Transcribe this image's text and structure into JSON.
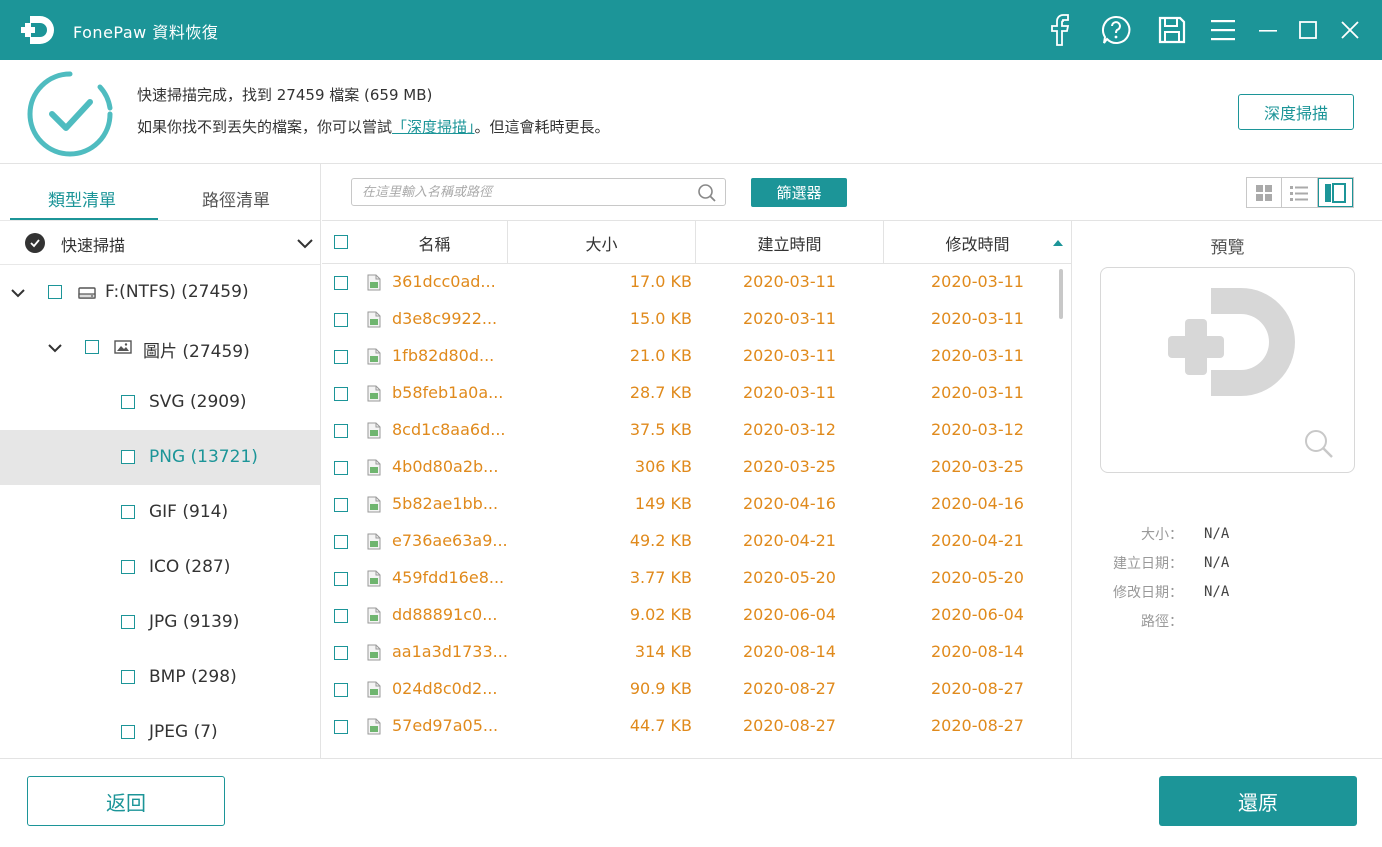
{
  "app": {
    "title": "FonePaw 資料恢復"
  },
  "status": {
    "line1": "快速掃描完成，找到 27459 檔案 (659 MB)",
    "line2_prefix": "如果你找不到丟失的檔案，你可以嘗試",
    "line2_link": "「深度掃描」",
    "line2_suffix": "。但這會耗時更長。",
    "deep_scan_button": "深度掃描"
  },
  "left_panel": {
    "tabs": [
      {
        "label": "類型清單"
      },
      {
        "label": "路徑清單"
      }
    ],
    "scan_mode": "快速掃描",
    "tree": [
      {
        "label": "F:(NTFS) (27459)",
        "level": 0
      },
      {
        "label": "圖片 (27459)",
        "level": 1
      },
      {
        "label": "SVG (2909)",
        "level": 2
      },
      {
        "label": "PNG (13721)",
        "level": 2
      },
      {
        "label": "GIF (914)",
        "level": 2
      },
      {
        "label": "ICO (287)",
        "level": 2
      },
      {
        "label": "JPG (9139)",
        "level": 2
      },
      {
        "label": "BMP (298)",
        "level": 2
      },
      {
        "label": "JPEG (7)",
        "level": 2
      }
    ]
  },
  "toolbar": {
    "search_placeholder": "在這里輸入名稱或路徑",
    "filter_button": "篩選器"
  },
  "table": {
    "headers": {
      "name": "名稱",
      "size": "大小",
      "created": "建立時間",
      "modified": "修改時間"
    },
    "rows": [
      {
        "name": "361dcc0ad...",
        "size": "17.0 KB",
        "created": "2020-03-11",
        "modified": "2020-03-11"
      },
      {
        "name": "d3e8c9922...",
        "size": "15.0 KB",
        "created": "2020-03-11",
        "modified": "2020-03-11"
      },
      {
        "name": "1fb82d80d...",
        "size": "21.0 KB",
        "created": "2020-03-11",
        "modified": "2020-03-11"
      },
      {
        "name": "b58feb1a0a...",
        "size": "28.7 KB",
        "created": "2020-03-11",
        "modified": "2020-03-11"
      },
      {
        "name": "8cd1c8aa6d...",
        "size": "37.5 KB",
        "created": "2020-03-12",
        "modified": "2020-03-12"
      },
      {
        "name": "4b0d80a2b...",
        "size": "306 KB",
        "created": "2020-03-25",
        "modified": "2020-03-25"
      },
      {
        "name": "5b82ae1bb...",
        "size": "149 KB",
        "created": "2020-04-16",
        "modified": "2020-04-16"
      },
      {
        "name": "e736ae63a9...",
        "size": "49.2 KB",
        "created": "2020-04-21",
        "modified": "2020-04-21"
      },
      {
        "name": "459fdd16e8...",
        "size": "3.77 KB",
        "created": "2020-05-20",
        "modified": "2020-05-20"
      },
      {
        "name": "dd88891c0...",
        "size": "9.02 KB",
        "created": "2020-06-04",
        "modified": "2020-06-04"
      },
      {
        "name": "aa1a3d1733...",
        "size": "314 KB",
        "created": "2020-08-14",
        "modified": "2020-08-14"
      },
      {
        "name": "024d8c0d2...",
        "size": "90.9 KB",
        "created": "2020-08-27",
        "modified": "2020-08-27"
      },
      {
        "name": "57ed97a05...",
        "size": "44.7 KB",
        "created": "2020-08-27",
        "modified": "2020-08-27"
      }
    ]
  },
  "preview": {
    "title": "預覽",
    "size_label": "大小：",
    "size_value": "N/A",
    "created_label": "建立日期：",
    "created_value": "N/A",
    "modified_label": "修改日期：",
    "modified_value": "N/A",
    "path_label": "路徑："
  },
  "footer": {
    "back_button": "返回",
    "restore_button": "還原"
  },
  "colors": {
    "accent": "#1c9598",
    "file_text": "#e08a1c"
  }
}
